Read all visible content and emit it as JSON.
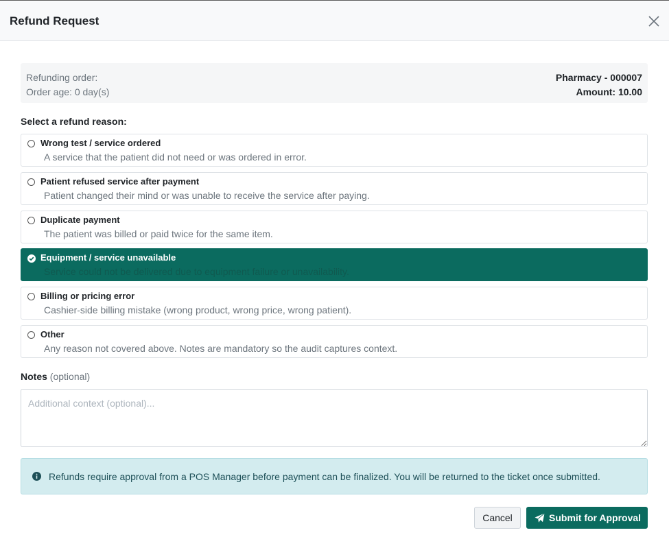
{
  "modal": {
    "title": "Refund Request"
  },
  "order": {
    "refunding_label": "Refunding order:",
    "age_label": "Order age: 0 day(s)",
    "order_id": "Pharmacy - 000007",
    "amount": "Amount: 10.00"
  },
  "reasons": {
    "heading": "Select a refund reason:",
    "items": [
      {
        "title": "Wrong test / service ordered",
        "desc": "A service that the patient did not need or was ordered in error.",
        "selected": false
      },
      {
        "title": "Patient refused service after payment",
        "desc": "Patient changed their mind or was unable to receive the service after paying.",
        "selected": false
      },
      {
        "title": "Duplicate payment",
        "desc": "The patient was billed or paid twice for the same item.",
        "selected": false
      },
      {
        "title": "Equipment / service unavailable",
        "desc": "Service could not be delivered due to equipment failure or unavailability.",
        "selected": true
      },
      {
        "title": "Billing or pricing error",
        "desc": "Cashier-side billing mistake (wrong product, wrong price, wrong patient).",
        "selected": false
      },
      {
        "title": "Other",
        "desc": "Any reason not covered above. Notes are mandatory so the audit captures context.",
        "selected": false
      }
    ]
  },
  "notes": {
    "label": "Notes",
    "optional": "(optional)",
    "value": "",
    "placeholder": "Additional context (optional)..."
  },
  "info": {
    "icon": "info-circle-icon",
    "text": "Refunds require approval from a POS Manager before payment can be finalized. You will be returned to the ticket once submitted."
  },
  "actions": {
    "cancel_label": "Cancel",
    "submit_label": "Submit for Approval",
    "submit_icon": "paper-plane-icon"
  },
  "colors": {
    "accent": "#0b6b5f",
    "info_bg": "#d3ecef"
  }
}
